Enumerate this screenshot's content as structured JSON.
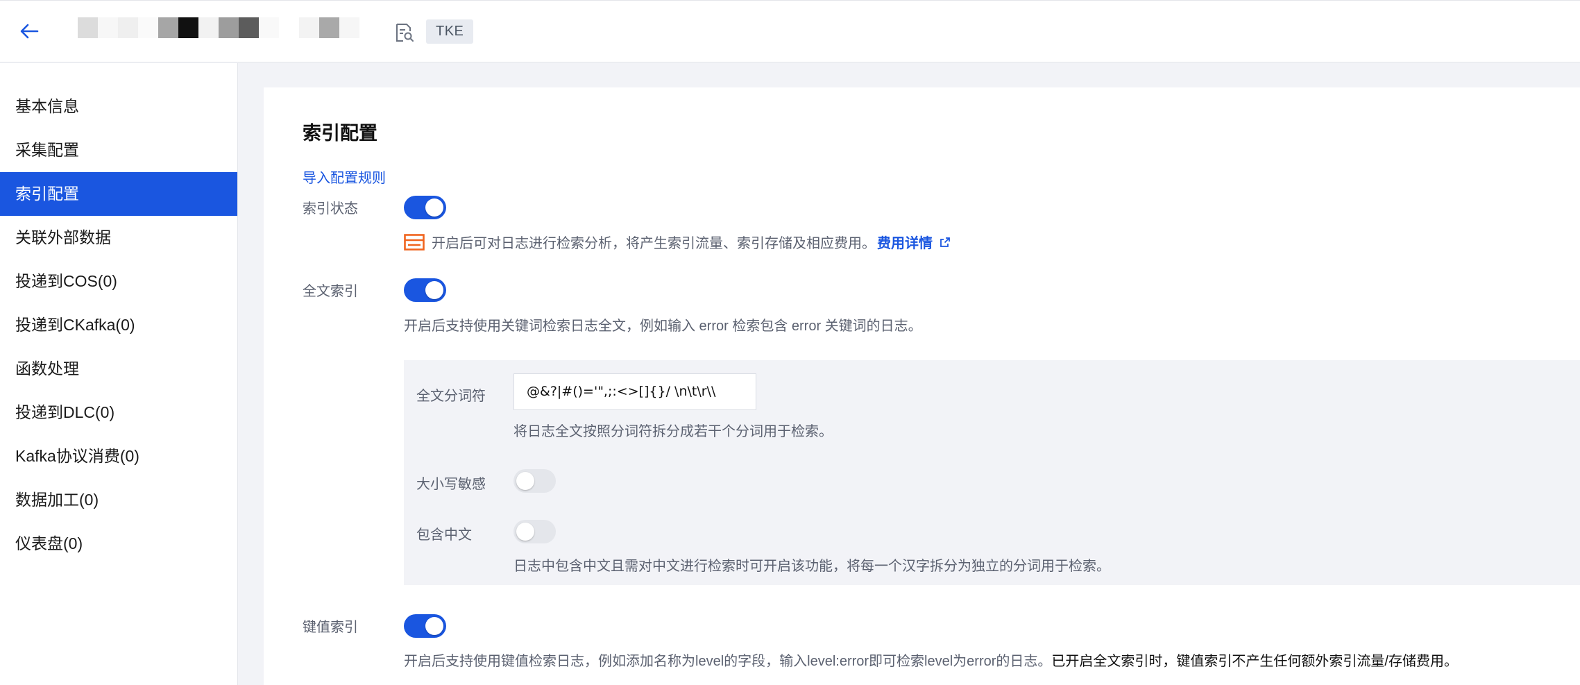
{
  "header": {
    "tag": "TKE"
  },
  "sidebar": {
    "items": [
      {
        "label": "基本信息",
        "active": false
      },
      {
        "label": "采集配置",
        "active": false
      },
      {
        "label": "索引配置",
        "active": true
      },
      {
        "label": "关联外部数据",
        "active": false
      },
      {
        "label": "投递到COS(0)",
        "active": false
      },
      {
        "label": "投递到CKafka(0)",
        "active": false
      },
      {
        "label": "函数处理",
        "active": false
      },
      {
        "label": "投递到DLC(0)",
        "active": false
      },
      {
        "label": "Kafka协议消费(0)",
        "active": false
      },
      {
        "label": "数据加工(0)",
        "active": false
      },
      {
        "label": "仪表盘(0)",
        "active": false
      }
    ]
  },
  "main": {
    "title": "索引配置",
    "import_link": "导入配置规则",
    "index_status": {
      "label": "索引状态",
      "enabled": true,
      "fee_note": "开启后可对日志进行检索分析，将产生索引流量、索引存储及相应费用。",
      "fee_link": "费用详情"
    },
    "full_text": {
      "label": "全文索引",
      "enabled": true,
      "desc": "开启后支持使用关键词检索日志全文，例如输入 error 检索包含 error 关键词的日志。",
      "delimiter": {
        "label": "全文分词符",
        "value": "@&?|#()='\",;:<>[]{}/ \\n\\t\\r\\\\",
        "hint": "将日志全文按照分词符拆分成若干个分词用于检索。"
      },
      "case_sensitive": {
        "label": "大小写敏感",
        "enabled": false
      },
      "chinese": {
        "label": "包含中文",
        "enabled": false,
        "hint": "日志中包含中文且需对中文进行检索时可开启该功能，将每一个汉字拆分为独立的分词用于检索。"
      }
    },
    "key_value": {
      "label": "键值索引",
      "enabled": true,
      "desc": "开启后支持使用键值检索日志，例如添加名称为level的字段，输入level:error即可检索level为error的日志。",
      "desc_strong": "已开启全文索引时，键值索引不产生任何额外索引流量/存储费用。"
    }
  },
  "colors": {
    "accent": "#1a56e0",
    "warning_icon": "#f0641e"
  }
}
